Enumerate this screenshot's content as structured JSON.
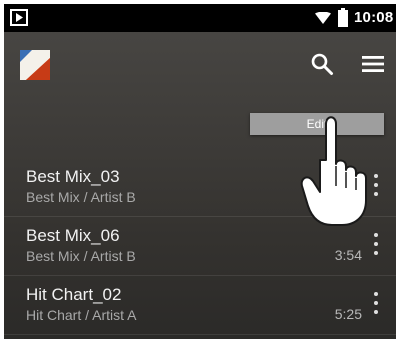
{
  "status_bar": {
    "time": "10:08",
    "play_icon": "play-store-icon",
    "wifi_icon": "wifi-icon",
    "battery_icon": "battery-icon"
  },
  "toolbar": {
    "logo_icon": "app-logo-icon",
    "search_icon": "search-icon",
    "menu_icon": "hamburger-menu-icon"
  },
  "popup": {
    "edit_label": "Edit"
  },
  "tracks": [
    {
      "title": "Best Mix_03",
      "subtitle": "Best Mix / Artist B",
      "duration": ""
    },
    {
      "title": "Best Mix_06",
      "subtitle": "Best Mix / Artist B",
      "duration": "3:54"
    },
    {
      "title": "Hit Chart_02",
      "subtitle": "Hit Chart / Artist A",
      "duration": "5:25"
    }
  ],
  "colors": {
    "background": "#3f3d3a",
    "status_bar": "#000000",
    "popup": "#9e9e9e",
    "text_primary": "#f2f2f2",
    "text_secondary": "#a9a9a9"
  }
}
